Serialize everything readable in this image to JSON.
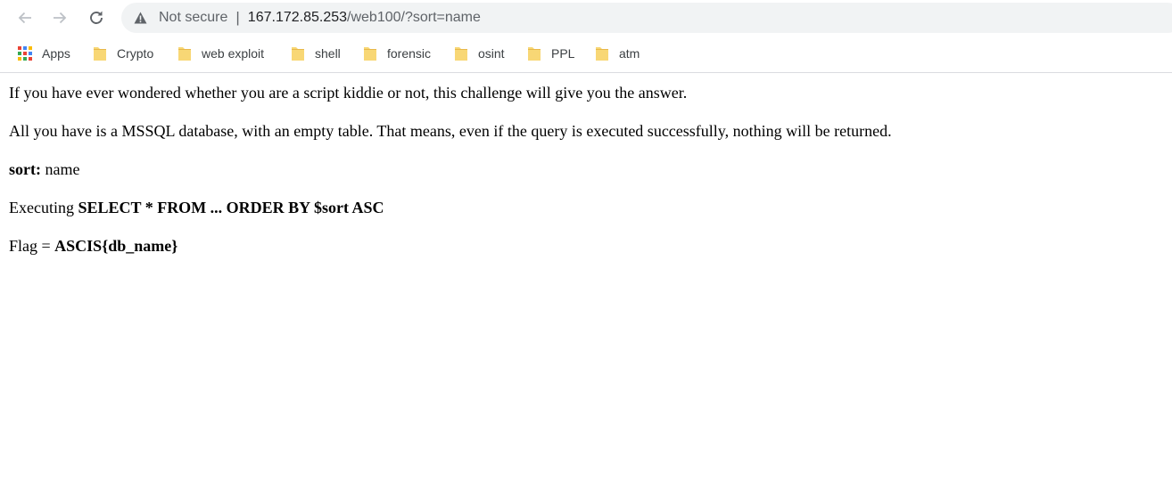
{
  "browser": {
    "not_secure_label": "Not secure",
    "separator": "|",
    "url_host": "167.172.85.253",
    "url_path": "/web100/?sort=name"
  },
  "bookmarks": {
    "apps_label": "Apps",
    "items": [
      {
        "label": "Crypto"
      },
      {
        "label": "web exploit"
      },
      {
        "label": "shell"
      },
      {
        "label": "forensic"
      },
      {
        "label": "osint"
      },
      {
        "label": "PPL"
      },
      {
        "label": "atm"
      }
    ]
  },
  "page": {
    "intro": "If you have ever wondered whether you are a script kiddie or not, this challenge will give you the answer.",
    "description": "All you have is a MSSQL database, with an empty table. That means, even if the query is executed successfully, nothing will be returned.",
    "sort_label": "sort:",
    "sort_value": " name",
    "executing_label": "Executing ",
    "query": "SELECT * FROM ... ORDER BY $sort ASC",
    "flag_label": "Flag = ",
    "flag_value": "ASCIS{db_name}"
  },
  "colors": {
    "folder": "#f8d775",
    "folder_tab": "#e8b84a",
    "omnibox_bg": "#f1f3f4",
    "apps_colors": [
      "#ea4335",
      "#4285f4",
      "#fbbc05",
      "#34a853",
      "#ea4335",
      "#4285f4",
      "#fbbc05",
      "#34a853",
      "#ea4335"
    ]
  }
}
